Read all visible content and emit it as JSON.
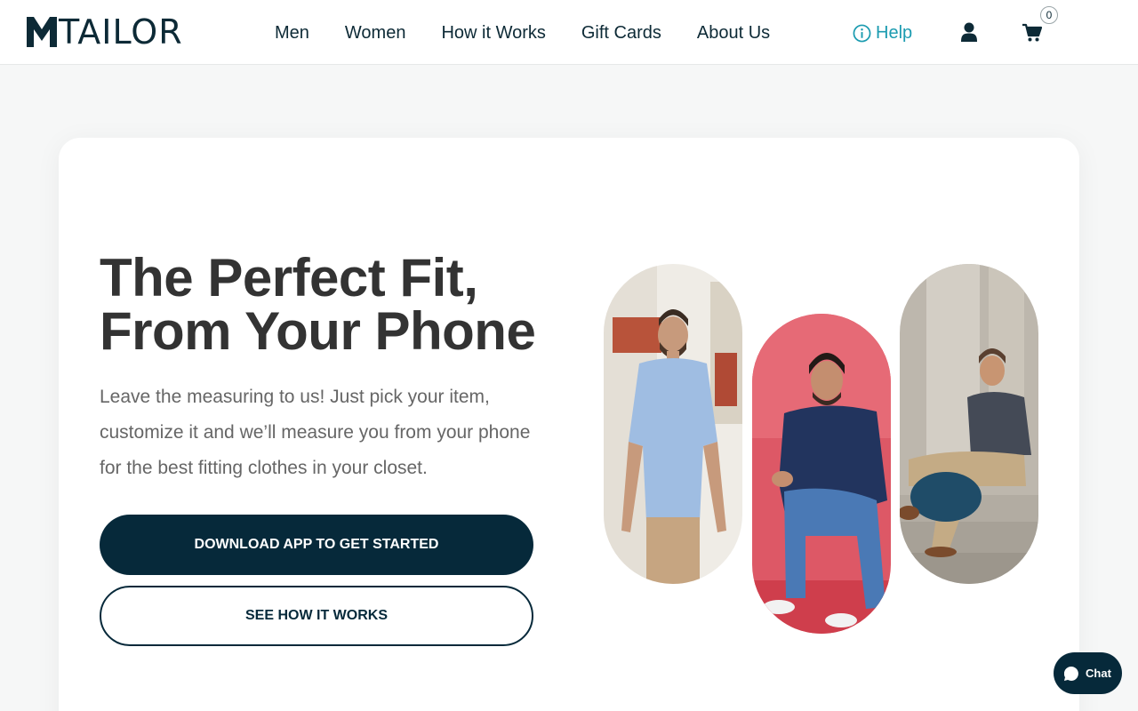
{
  "header": {
    "logo_text": "TAILOR",
    "nav": [
      "Men",
      "Women",
      "How it Works",
      "Gift Cards",
      "About Us"
    ],
    "help_label": "Help",
    "cart_count": "0"
  },
  "hero": {
    "title_line1": "The Perfect Fit,",
    "title_line2": "From Your Phone",
    "subtitle": "Leave the measuring to us! Just pick your item, customize it and we’ll measure you from your phone for the best fitting clothes in your closet.",
    "primary_cta": "DOWNLOAD APP TO GET STARTED",
    "secondary_cta": "SEE HOW IT WORKS"
  },
  "chat": {
    "label": "Chat"
  },
  "colors": {
    "brand_dark": "#06293a",
    "accent": "#1b9bb0"
  }
}
